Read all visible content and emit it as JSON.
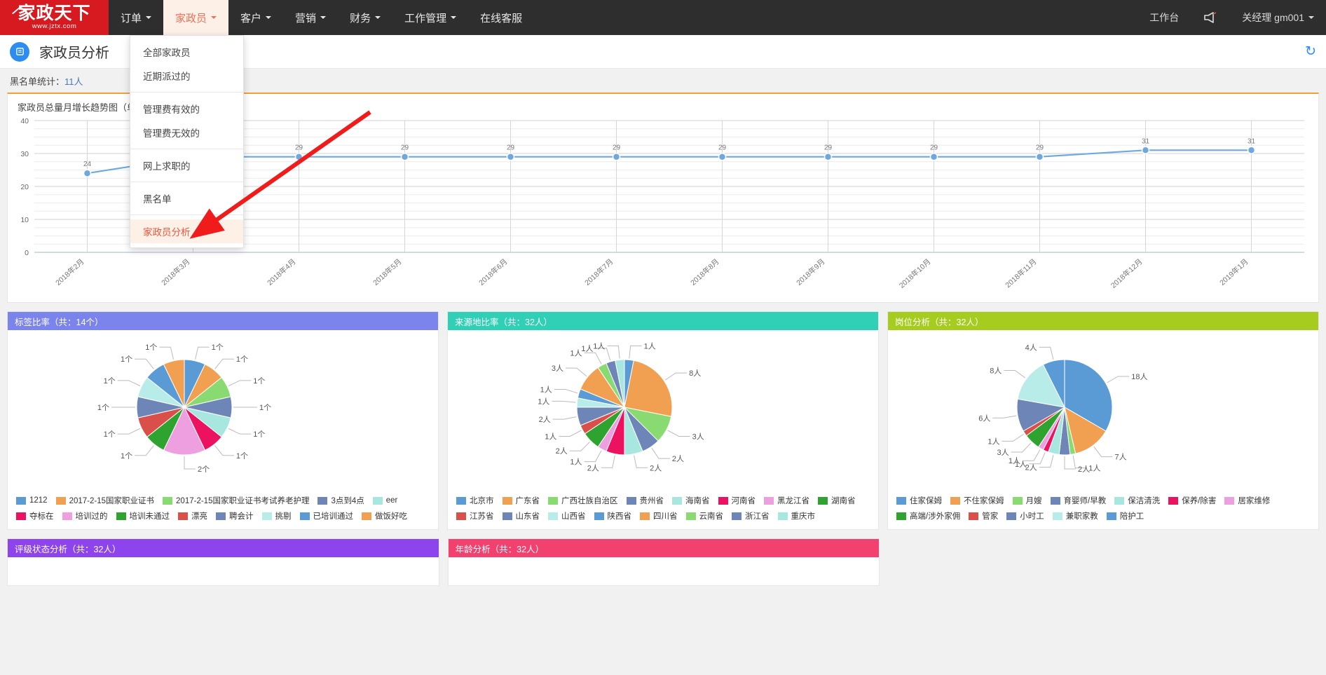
{
  "navbar": {
    "brand": {
      "name": "家政天下",
      "url": "www.jztx.com"
    },
    "items": [
      {
        "label": "订单",
        "caret": true,
        "active": false
      },
      {
        "label": "家政员",
        "caret": true,
        "active": true
      },
      {
        "label": "客户",
        "caret": true,
        "active": false
      },
      {
        "label": "营销",
        "caret": true,
        "active": false
      },
      {
        "label": "财务",
        "caret": true,
        "active": false
      },
      {
        "label": "工作管理",
        "caret": true,
        "active": false
      },
      {
        "label": "在线客服",
        "caret": false,
        "active": false
      }
    ],
    "right": {
      "workbench": "工作台",
      "megaphone_icon": "megaphone-icon",
      "user": "关经理 gm001"
    }
  },
  "dropdown": {
    "groups": [
      [
        "全部家政员",
        "近期派过的"
      ],
      [
        "管理费有效的",
        "管理费无效的"
      ],
      [
        "网上求职的"
      ],
      [
        "黑名单"
      ],
      [
        "家政员分析"
      ]
    ],
    "highlighted": "家政员分析"
  },
  "page": {
    "icon": "document-icon",
    "title": "家政员分析",
    "refresh_icon": "refresh-icon",
    "stat_label": "黑名单统计：",
    "stat_value": "11人"
  },
  "chart_data": [
    {
      "type": "line",
      "title": "家政员总量月增长趋势图（单位：人）",
      "xlabel": "",
      "ylabel": "",
      "ylim": [
        0,
        40
      ],
      "yticks": [
        0,
        10,
        20,
        30,
        40
      ],
      "grid": true,
      "categories": [
        "2018年2月",
        "2018年3月",
        "2018年4月",
        "2018年5月",
        "2018年6月",
        "2018年7月",
        "2018年8月",
        "2018年9月",
        "2018年10月",
        "2018年11月",
        "2018年12月",
        "2019年1月"
      ],
      "values": [
        24,
        29,
        29,
        29,
        29,
        29,
        29,
        29,
        29,
        29,
        31,
        31
      ],
      "series_color": "#6fa8dc"
    },
    {
      "type": "pie",
      "title": "标签比率（共：14个）",
      "header_color": "#7b84ec",
      "unit": "个",
      "labels": [
        "1212",
        "2017-2-15国家职业证书",
        "2017-2-15国家职业证书考试养老护理",
        "3点到4点",
        "eer",
        "夺标在",
        "培训过的",
        "培训未通过",
        "漂亮",
        "聘会计",
        "挑剔",
        "已培训通过",
        "做饭好吃"
      ],
      "values": [
        1,
        1,
        1,
        1,
        1,
        1,
        2,
        1,
        1,
        1,
        1,
        1,
        1
      ],
      "colors": [
        "#5b9bd5",
        "#f0a050",
        "#8ada72",
        "#6e85b7",
        "#a8e6e0",
        "#ec1260",
        "#ee9fe0",
        "#2fa32f",
        "#d9504a",
        "#6e85b7",
        "#b8ece8",
        "#5b9bd5",
        "#f0a050"
      ],
      "callout_labels": [
        "1个",
        "1个",
        "1个",
        "1个",
        "1个",
        "1个",
        "1个",
        "1个",
        "1个",
        "2个",
        "1个",
        "1个",
        "1个"
      ]
    },
    {
      "type": "pie",
      "title": "来源地比率（共：32人）",
      "header_color": "#2fd0b5",
      "unit": "人",
      "labels": [
        "北京市",
        "广东省",
        "广西壮族自治区",
        "贵州省",
        "海南省",
        "河南省",
        "黑龙江省",
        "湖南省",
        "江苏省",
        "山东省",
        "山西省",
        "陕西省",
        "四川省",
        "云南省",
        "浙江省",
        "重庆市"
      ],
      "values": [
        1,
        8,
        3,
        2,
        2,
        2,
        1,
        2,
        1,
        2,
        1,
        1,
        3,
        1,
        1,
        1
      ],
      "colors": [
        "#5b9bd5",
        "#f0a050",
        "#8ada72",
        "#6e85b7",
        "#a8e6e0",
        "#ec1260",
        "#ee9fe0",
        "#2fa32f",
        "#d9504a",
        "#6e85b7",
        "#b8ece8",
        "#5b9bd5",
        "#f0a050",
        "#8ada72",
        "#6e85b7",
        "#a8e6e0"
      ],
      "callout_labels": [
        "1人",
        "1人",
        "8人",
        "3人",
        "2人",
        "2人",
        "2人",
        "1人",
        "2人",
        "1人",
        "1人",
        "1人",
        "3人"
      ]
    },
    {
      "type": "pie",
      "title": "岗位分析（共：32人）",
      "header_color": "#a6cc1f",
      "unit": "人",
      "labels": [
        "住家保姆",
        "不住家保姆",
        "月嫂",
        "育婴师/早教",
        "保洁清洗",
        "保养/除害",
        "居家维修",
        "高端/涉外家佣",
        "管家",
        "小时工",
        "兼职家教",
        "陪护工"
      ],
      "values": [
        18,
        7,
        1,
        2,
        2,
        1,
        1,
        3,
        1,
        6,
        8,
        4
      ],
      "colors": [
        "#5b9bd5",
        "#f0a050",
        "#8ada72",
        "#6e85b7",
        "#a8e6e0",
        "#ec1260",
        "#ee9fe0",
        "#2fa32f",
        "#d9504a",
        "#6e85b7",
        "#b8ece8",
        "#5b9bd5"
      ],
      "callout_labels": [
        "4人",
        "8人",
        "18人",
        "6人",
        "3人",
        "2人",
        "1人",
        "2人",
        "1人",
        "7人",
        "1人"
      ]
    }
  ],
  "bottom_panels": [
    {
      "title": "评级状态分析（共：32人）",
      "header_color": "#8e44ec"
    },
    {
      "title": "年龄分析（共：32人）",
      "header_color": "#f2406f"
    }
  ]
}
